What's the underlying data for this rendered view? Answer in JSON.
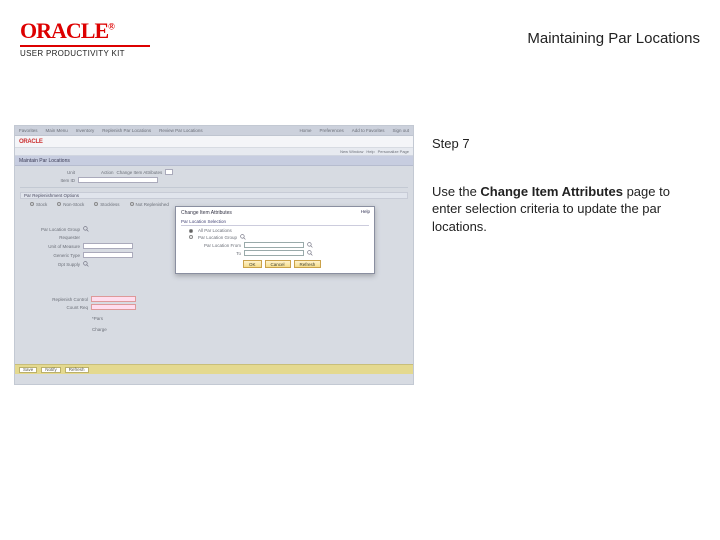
{
  "header": {
    "logo_text": "ORACLE",
    "logo_sub": "USER PRODUCTIVITY KIT",
    "doc_title": "Maintaining Par Locations"
  },
  "right": {
    "step": "Step 7",
    "instr_pre": "Use the ",
    "instr_bold": "Change Item Attributes",
    "instr_post": " page to enter selection criteria to update the par locations."
  },
  "shot": {
    "topnav": [
      "Favorites",
      "Main Menu",
      "Inventory",
      "Replenish Par Locations",
      "Review Par Locations"
    ],
    "topright": [
      "Home",
      "Preferences",
      "Add to Favorites",
      "Sign out"
    ],
    "brand": "ORACLE",
    "subbar": [
      "New Window",
      "Help",
      "Personalize Page"
    ],
    "page_title": "Maintain Par Locations",
    "row_unit": "Unit",
    "row_action": "Action",
    "val_action": "Change Item Attributes",
    "row_itemid": "Item ID",
    "section_options": "Par Replenishment Options",
    "radios": [
      "Stock",
      "Non-Stock",
      "Stockless",
      "Not Replenished"
    ],
    "left": {
      "par_group": "Par Location Group",
      "requester": "Requester",
      "unit_of_measure": "Unit of Measure",
      "generic_type": "Generic Type",
      "opt_supply": "Opt Supply"
    },
    "xtra": {
      "replenish_control": "Replenish Control",
      "count_req": "Count Req",
      "pars": "*Pars",
      "charge": "Charge"
    },
    "popup": {
      "title": "Change Item Attributes",
      "help": "Help",
      "section": "Par Location Selection",
      "radio_all": "All Par Locations",
      "radio_group": "Par Location Group",
      "from_label": "Par Location From",
      "to_label": "To",
      "btn_ok": "OK",
      "btn_cancel": "Cancel",
      "btn_refresh": "Refresh"
    },
    "footer": {
      "save": "Save",
      "notify": "Notify",
      "refresh": "Refresh"
    }
  }
}
